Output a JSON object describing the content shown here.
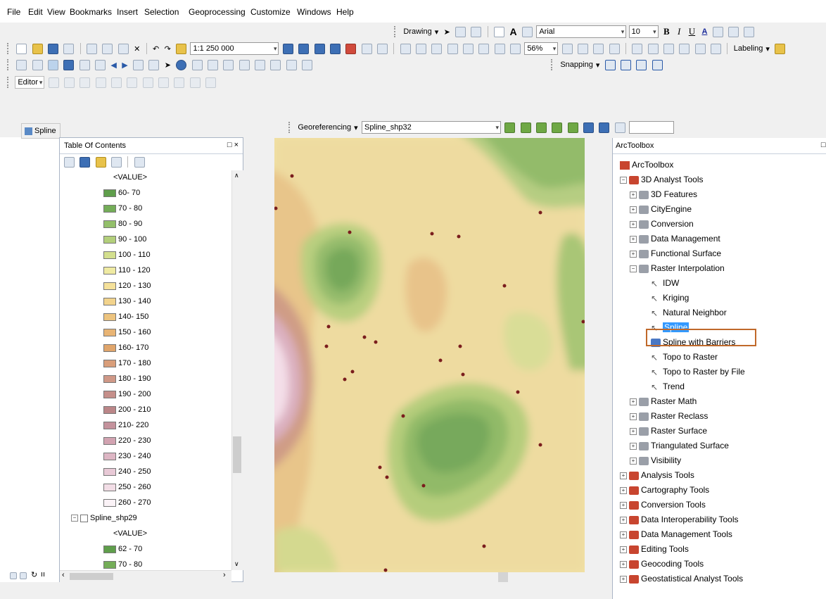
{
  "menu": [
    "File",
    "Edit",
    "View",
    "Bookmarks",
    "Insert",
    "Selection",
    "Geoprocessing",
    "Customize",
    "Windows",
    "Help"
  ],
  "drawing_toolbar": {
    "drawing_label": "Drawing",
    "font_name": "Arial",
    "font_size": "10",
    "bold": "B",
    "italic": "I",
    "underline": "U"
  },
  "standard_toolbar": {
    "scale": "1:1 250 000",
    "zoom": "56%",
    "labeling_label": "Labeling"
  },
  "snapping": {
    "label": "Snapping"
  },
  "editor": {
    "label": "Editor"
  },
  "georeferencing": {
    "label": "Georeferencing",
    "layer": "Spline_shp32"
  },
  "leftdock": {
    "tab_label": "Spline"
  },
  "toc": {
    "title": "Table Of Contents",
    "close": "□ ×",
    "group1": {
      "value_header": "<VALUE>",
      "classes": [
        {
          "label": "60- 70",
          "color": "#5f9e4b"
        },
        {
          "label": "70 - 80",
          "color": "#74ad58"
        },
        {
          "label": "80 - 90",
          "color": "#93bf6a"
        },
        {
          "label": "90 - 100",
          "color": "#b3cf7b"
        },
        {
          "label": "100 - 110",
          "color": "#d3df8e"
        },
        {
          "label": "110 - 120",
          "color": "#efeaa2"
        },
        {
          "label": "120 - 130",
          "color": "#f5e19a"
        },
        {
          "label": "130 - 140",
          "color": "#f2d38c"
        },
        {
          "label": "140- 150",
          "color": "#edc47f"
        },
        {
          "label": "150 - 160",
          "color": "#e8b474"
        },
        {
          "label": "160- 170",
          "color": "#e0a56b"
        },
        {
          "label": "170 - 180",
          "color": "#d99e7a"
        },
        {
          "label": "180 - 190",
          "color": "#cf9887"
        },
        {
          "label": "190 - 200",
          "color": "#c58f8a"
        },
        {
          "label": "200 - 210",
          "color": "#bb8688"
        },
        {
          "label": "210- 220",
          "color": "#c4929c"
        },
        {
          "label": "220 - 230",
          "color": "#d2a3b1"
        },
        {
          "label": "230 - 240",
          "color": "#ddb6c4"
        },
        {
          "label": "240 - 250",
          "color": "#e8c9d6"
        },
        {
          "label": "250 - 260",
          "color": "#f2dde6"
        },
        {
          "label": "260 - 270",
          "color": "#fbf3f7"
        }
      ]
    },
    "layer2": {
      "name": "Spline_shp29",
      "value_header": "<VALUE>",
      "classes": [
        {
          "label": "62 - 70",
          "color": "#5f9e4b"
        },
        {
          "label": "70 - 80",
          "color": "#74ad58"
        }
      ]
    }
  },
  "toolbox": {
    "title": "ArcToolbox",
    "close": "□ ×",
    "root": "ArcToolbox",
    "items": [
      {
        "label": "3D Analyst Tools",
        "level": 1,
        "exp": "-",
        "icon": "toolbox"
      },
      {
        "label": "3D Features",
        "level": 2,
        "exp": "+",
        "icon": "toolset"
      },
      {
        "label": "CityEngine",
        "level": 2,
        "exp": "+",
        "icon": "toolset"
      },
      {
        "label": "Conversion",
        "level": 2,
        "exp": "+",
        "icon": "toolset"
      },
      {
        "label": "Data Management",
        "level": 2,
        "exp": "+",
        "icon": "toolset"
      },
      {
        "label": "Functional Surface",
        "level": 2,
        "exp": "+",
        "icon": "toolset"
      },
      {
        "label": "Raster Interpolation",
        "level": 2,
        "exp": "-",
        "icon": "toolset"
      },
      {
        "label": "IDW",
        "level": 3,
        "exp": "",
        "icon": "tool"
      },
      {
        "label": "Kriging",
        "level": 3,
        "exp": "",
        "icon": "tool"
      },
      {
        "label": "Natural Neighbor",
        "level": 3,
        "exp": "",
        "icon": "tool"
      },
      {
        "label": "Spline",
        "level": 3,
        "exp": "",
        "icon": "tool",
        "selected": true
      },
      {
        "label": "Spline with Barriers",
        "level": 3,
        "exp": "",
        "icon": "script"
      },
      {
        "label": "Topo to Raster",
        "level": 3,
        "exp": "",
        "icon": "tool"
      },
      {
        "label": "Topo to Raster by File",
        "level": 3,
        "exp": "",
        "icon": "tool"
      },
      {
        "label": "Trend",
        "level": 3,
        "exp": "",
        "icon": "tool"
      },
      {
        "label": "Raster Math",
        "level": 2,
        "exp": "+",
        "icon": "toolset"
      },
      {
        "label": "Raster Reclass",
        "level": 2,
        "exp": "+",
        "icon": "toolset"
      },
      {
        "label": "Raster Surface",
        "level": 2,
        "exp": "+",
        "icon": "toolset"
      },
      {
        "label": "Triangulated Surface",
        "level": 2,
        "exp": "+",
        "icon": "toolset"
      },
      {
        "label": "Visibility",
        "level": 2,
        "exp": "+",
        "icon": "toolset"
      },
      {
        "label": "Analysis Tools",
        "level": 1,
        "exp": "+",
        "icon": "toolbox"
      },
      {
        "label": "Cartography Tools",
        "level": 1,
        "exp": "+",
        "icon": "toolbox"
      },
      {
        "label": "Conversion Tools",
        "level": 1,
        "exp": "+",
        "icon": "toolbox"
      },
      {
        "label": "Data Interoperability Tools",
        "level": 1,
        "exp": "+",
        "icon": "toolbox"
      },
      {
        "label": "Data Management Tools",
        "level": 1,
        "exp": "+",
        "icon": "toolbox"
      },
      {
        "label": "Editing Tools",
        "level": 1,
        "exp": "+",
        "icon": "toolbox"
      },
      {
        "label": "Geocoding Tools",
        "level": 1,
        "exp": "+",
        "icon": "toolbox"
      },
      {
        "label": "Geostatistical Analyst Tools",
        "level": 1,
        "exp": "+",
        "icon": "toolbox"
      }
    ]
  },
  "colors": {
    "highlight_box": "#c0692a",
    "selection": "#3399ff"
  }
}
